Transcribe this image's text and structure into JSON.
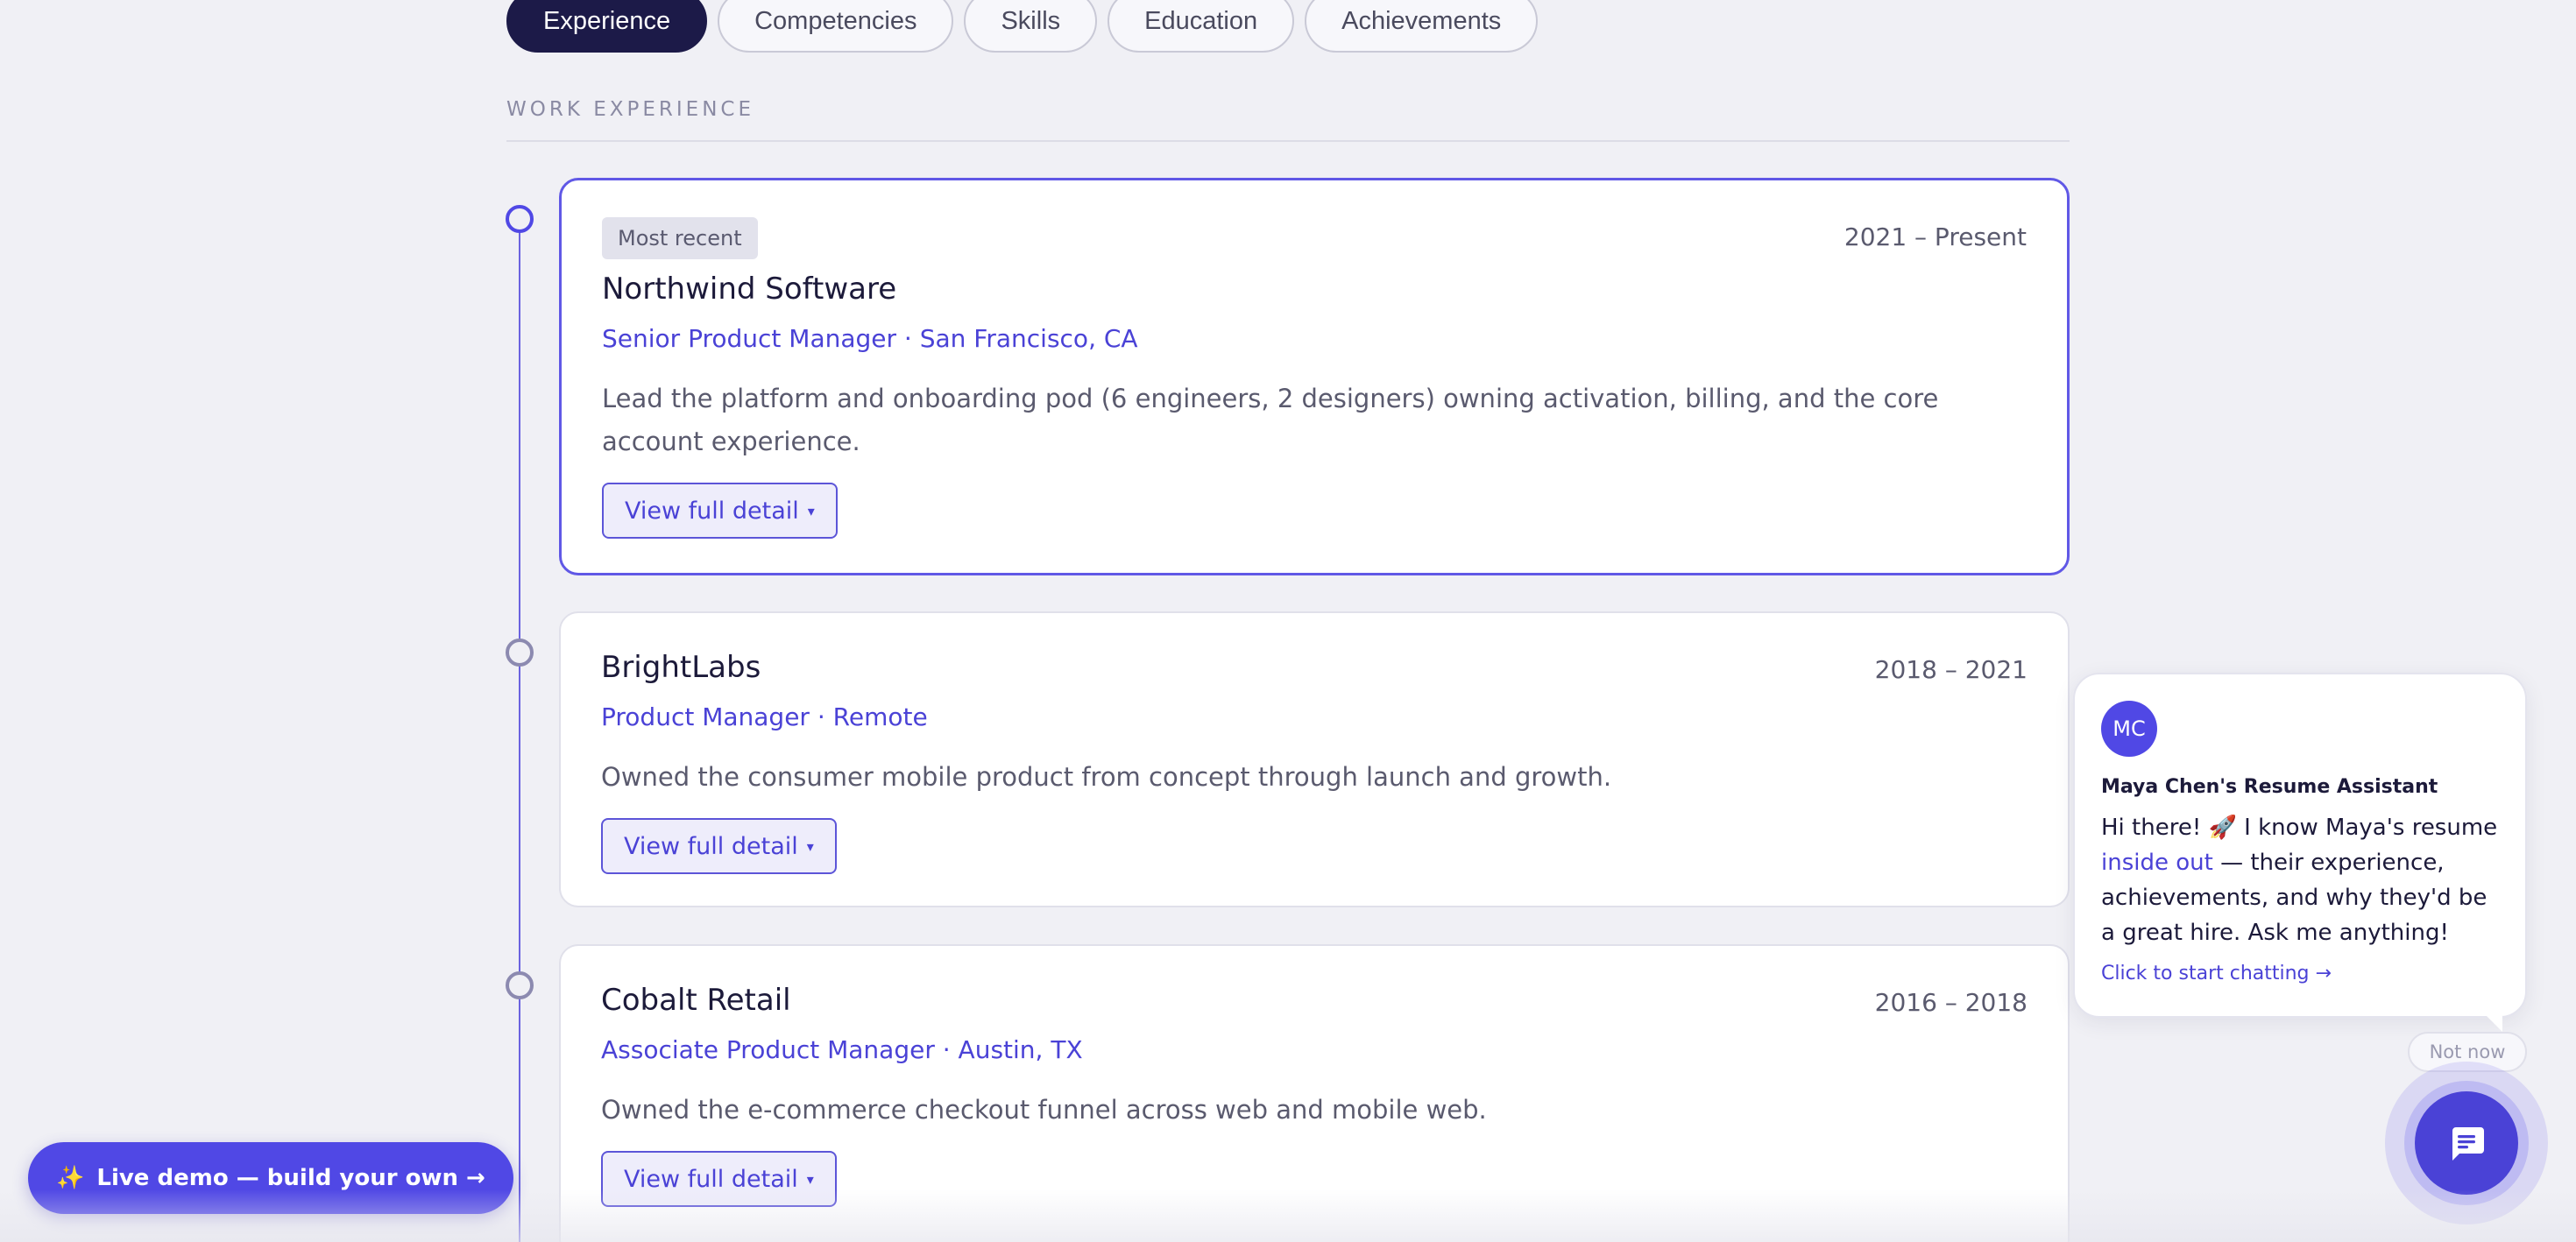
{
  "tabs": [
    {
      "label": "Experience",
      "active": true
    },
    {
      "label": "Competencies",
      "active": false
    },
    {
      "label": "Skills",
      "active": false
    },
    {
      "label": "Education",
      "active": false
    },
    {
      "label": "Achievements",
      "active": false
    }
  ],
  "section_title": "WORK EXPERIENCE",
  "jobs": [
    {
      "badge": "Most recent",
      "company": "Northwind Software",
      "role": "Senior Product Manager · San Francisco, CA",
      "dates": "2021 – Present",
      "description": "Lead the platform and onboarding pod (6 engineers, 2 designers) owning activation, billing, and the core account experience.",
      "detail_label": "View full detail",
      "caret": "▾"
    },
    {
      "company": "BrightLabs",
      "role": "Product Manager · Remote",
      "dates": "2018 – 2021",
      "description": "Owned the consumer mobile product from concept through launch and growth.",
      "detail_label": "View full detail",
      "caret": "▾"
    },
    {
      "company": "Cobalt Retail",
      "role": "Associate Product Manager · Austin, TX",
      "dates": "2016 – 2018",
      "description": "Owned the e-commerce checkout funnel across web and mobile web.",
      "detail_label": "View full detail",
      "caret": "▾"
    }
  ],
  "chat": {
    "avatar_initials": "MC",
    "name": "Maya Chen's Resume Assistant",
    "msg_before": "Hi there! 🚀 I know Maya's resume ",
    "msg_highlight": "inside out",
    "msg_after": " — their experience, achievements, and why they'd be a great hire. Ask me anything!",
    "cta": "Click to start chatting →",
    "dismiss": "Not now",
    "fab_icon": "chat-bubble-icon"
  },
  "demo_button": {
    "icon": "✨",
    "label": "Live demo — build your own →"
  },
  "colors": {
    "accent": "#5048e5",
    "active_tab": "#1c1a48",
    "background": "#f0f0f5"
  }
}
